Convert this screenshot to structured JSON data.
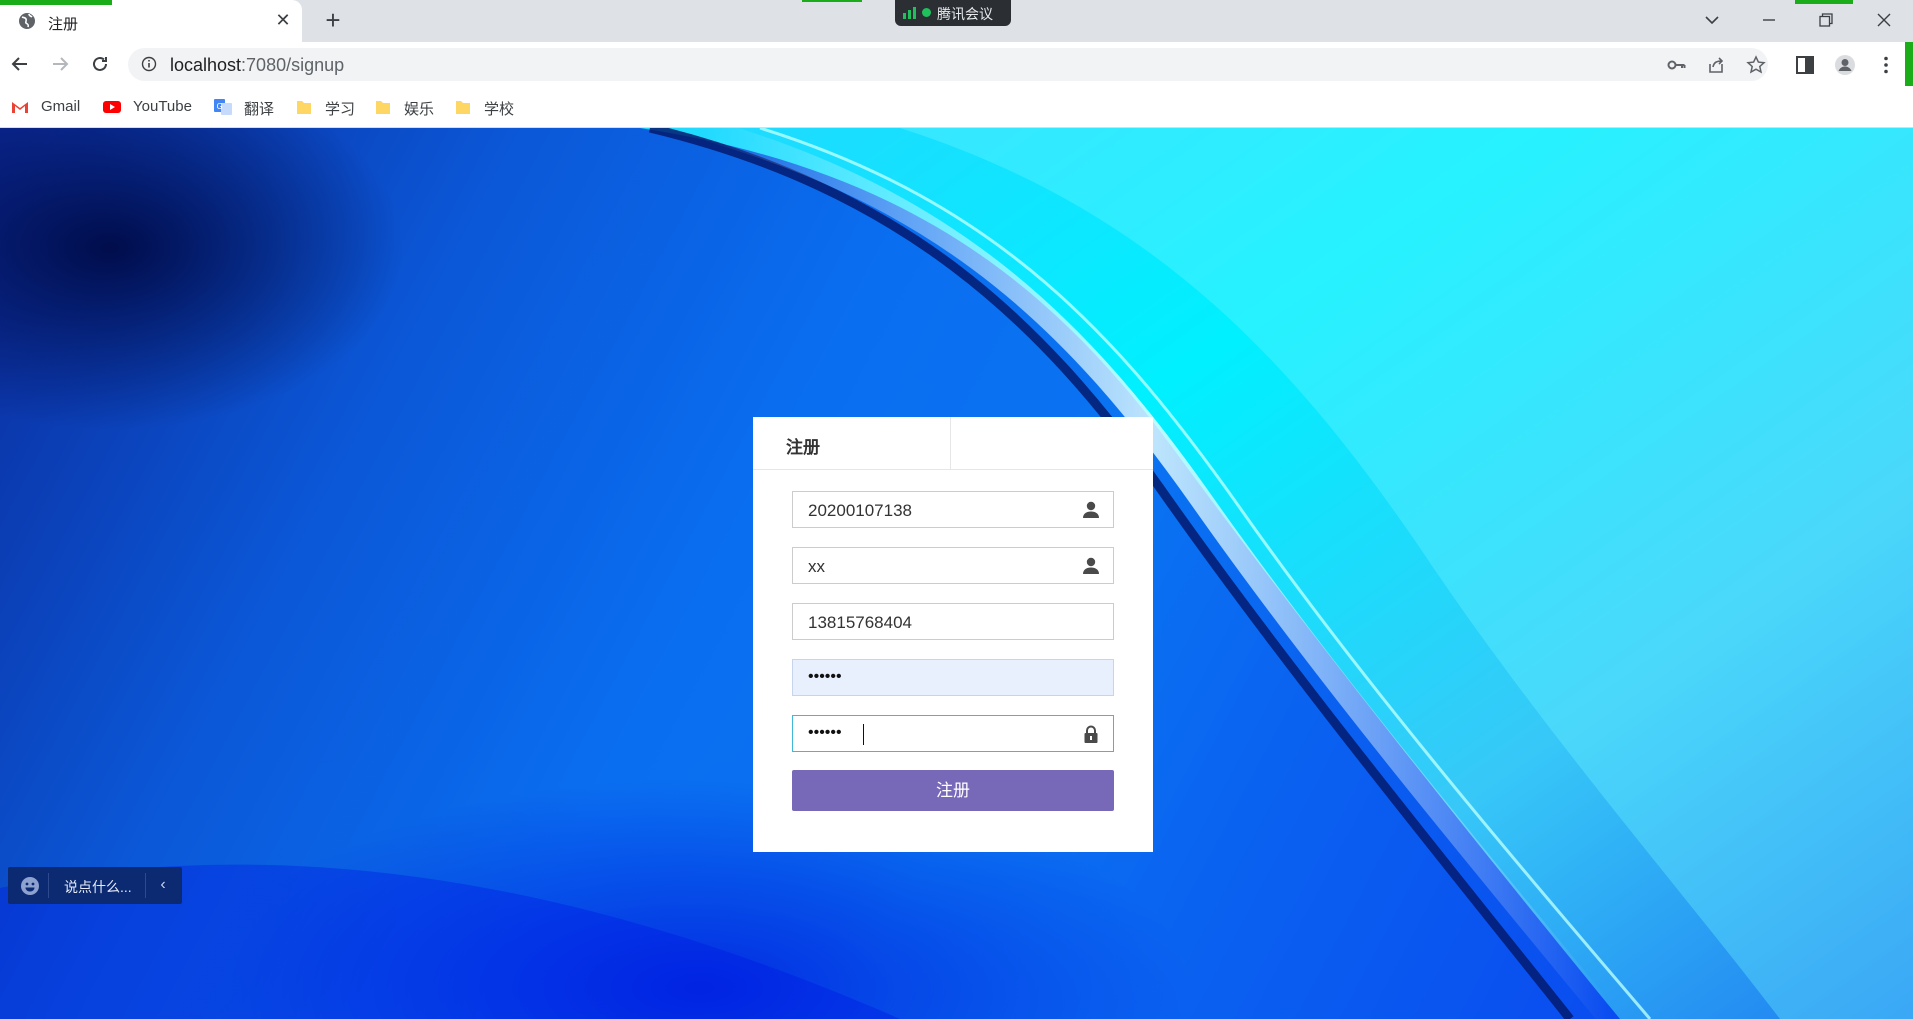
{
  "browser": {
    "tab": {
      "title": "注册",
      "favicon": "globe-icon"
    },
    "meeting_indicator": {
      "label": "腾讯会议"
    },
    "address": {
      "host": "localhost",
      "rest": ":7080/signup"
    },
    "bookmarks": [
      {
        "label": "Gmail",
        "icon": "gmail-icon"
      },
      {
        "label": "YouTube",
        "icon": "youtube-icon"
      },
      {
        "label": "翻译",
        "icon": "translate-icon"
      },
      {
        "label": "学习",
        "icon": "folder-icon"
      },
      {
        "label": "娱乐",
        "icon": "folder-icon"
      },
      {
        "label": "学校",
        "icon": "folder-icon"
      }
    ]
  },
  "signup": {
    "tab_label": "注册",
    "fields": {
      "student_id": "20200107138",
      "name": "xx",
      "phone": "13815768404",
      "password_mask": "••••••",
      "confirm_mask": "••••••"
    },
    "submit_label": "注册"
  },
  "chat_widget": {
    "placeholder": "说点什么..."
  },
  "colors": {
    "accent_green": "#1aad19",
    "submit_button": "#7868b8",
    "focus_border": "#3fb9d8"
  }
}
